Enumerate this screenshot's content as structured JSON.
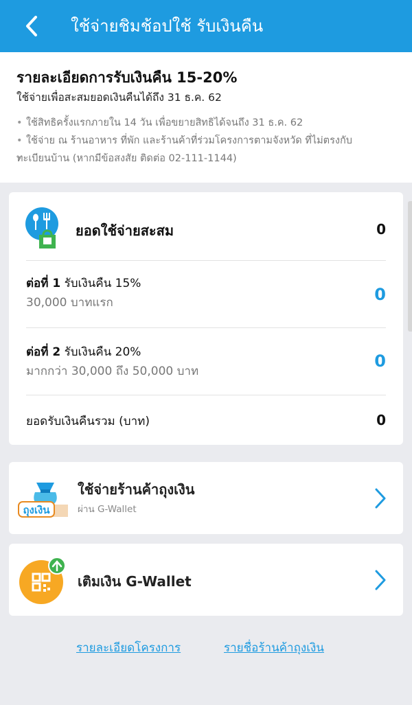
{
  "header": {
    "title": "ใช้จ่ายชิมช้อปใช้ รับเงินคืน",
    "back_icon": "chevron-left-icon",
    "color": "#1e9be0"
  },
  "info": {
    "title": "รายละเอียดการรับเงินคืน 15-20%",
    "subtitle": "ใช้จ่ายเพื่อสะสมยอดเงินคืนได้ถึง 31 ธ.ค. 62",
    "notes": [
      "ใช้สิทธิครั้งแรกภายใน 14 วัน เพื่อขยายสิทธิได้จนถึง 31 ธ.ค. 62",
      "ใช้จ่าย ณ ร้านอาหาร ที่พัก และร้านค้าที่ร่วมโครงการตามจังหวัด ที่ไม่ตรงกับ",
      "ทะเบียนบ้าน (หากมีข้อสงสัย ติดต่อ 02-111-1144)"
    ]
  },
  "summary": {
    "total_label": "ยอดใช้จ่ายสะสม",
    "total_value": "0",
    "tier1": {
      "label_bold": "ต่อที่ 1",
      "label_rest": " รับเงินคืน 15%",
      "sub": "30,000 บาทแรก",
      "value": "0"
    },
    "tier2": {
      "label_bold": "ต่อที่ 2",
      "label_rest": " รับเงินคืน 20%",
      "sub": "มากกว่า 30,000 ถึง 50,000 บาท",
      "value": "0"
    },
    "cashback_label": "ยอดรับเงินคืนรวม (บาท)",
    "cashback_value": "0"
  },
  "shop_card": {
    "title": "ใช้จ่ายร้านค้าถุงเงิน",
    "subtitle": "ผ่าน G-Wallet",
    "logo_text": "ถุงเงิน",
    "icon": "tung-ngern-logo-icon"
  },
  "wallet_card": {
    "title": "เติมเงิน G-Wallet",
    "icon": "qr-topup-icon"
  },
  "links": {
    "details": "รายละเอียดโครงการ",
    "shops": "รายชื่อร้านค้าถุงเงิน"
  },
  "colors": {
    "accent": "#1e9be0",
    "background": "#eaebef",
    "wallet_icon": "#f7a823",
    "wallet_arrow": "#3fb34f"
  }
}
